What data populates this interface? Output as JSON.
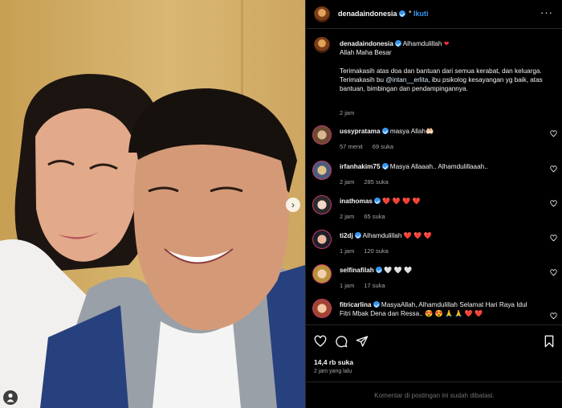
{
  "header": {
    "username": "denadaindonesia",
    "separator": "•",
    "follow_label": "Ikuti",
    "more_label": "···"
  },
  "caption": {
    "username": "denadaindonesia",
    "line1": "Alhamdulillah",
    "line2": "Allah Maha Besar",
    "para1": "Terimakasih atas doa dan bantuan dari semua kerabat, dan keluarga.",
    "para2_start": "Terimakasih bu ",
    "mention": "@intan__erlita",
    "para2_end": ", ibu psikolog kesayangan yg baik, atas bantuan, bimbingan dan pendampingannya.",
    "time": "2 jam"
  },
  "comments": [
    {
      "username": "ussypratama",
      "text": "masya Allah🤲🏻",
      "time": "57 menit",
      "likes": "69 suka"
    },
    {
      "username": "irfanhakim75",
      "text": "Masya Allaaah.. Alhamdulillaaah..",
      "time": "2 jam",
      "likes": "285 suka"
    },
    {
      "username": "inathomas",
      "text": "❤️ ❤️ ❤️ ❤️",
      "time": "2 jam",
      "likes": "65 suka"
    },
    {
      "username": "ti2dj",
      "text": "Alhamdulillah ❤️ ❤️ ❤️",
      "time": "1 jam",
      "likes": "120 suka"
    },
    {
      "username": "selfinafilah",
      "text": "🤍 🤍 🤍",
      "time": "1 jam",
      "likes": "17 suka"
    },
    {
      "username": "fitricarlina",
      "text": "MasyaAllah, Alhamdulillah Selamat Hari Raya Idul Fitri Mbak Dena dan Ressa.. 😍 😍 🙏 🙏 ❤️ ❤️",
      "time": "",
      "likes": ""
    }
  ],
  "footer": {
    "likes": "14,4 rb suka",
    "posted": "2 jam yang lalu",
    "comments_closed": "Komentar di postingan ini sudah dibatasi."
  },
  "colors": {
    "background": "#000000",
    "text": "#f5f5f5",
    "muted": "#a8a8a8",
    "link": "#3797f0",
    "heart": "#ff3040"
  },
  "icons": [
    "verified-badge-icon",
    "more-icon",
    "heart-outline-icon",
    "comment-icon",
    "share-icon",
    "bookmark-icon",
    "next-arrow-icon",
    "tag-user-icon"
  ]
}
